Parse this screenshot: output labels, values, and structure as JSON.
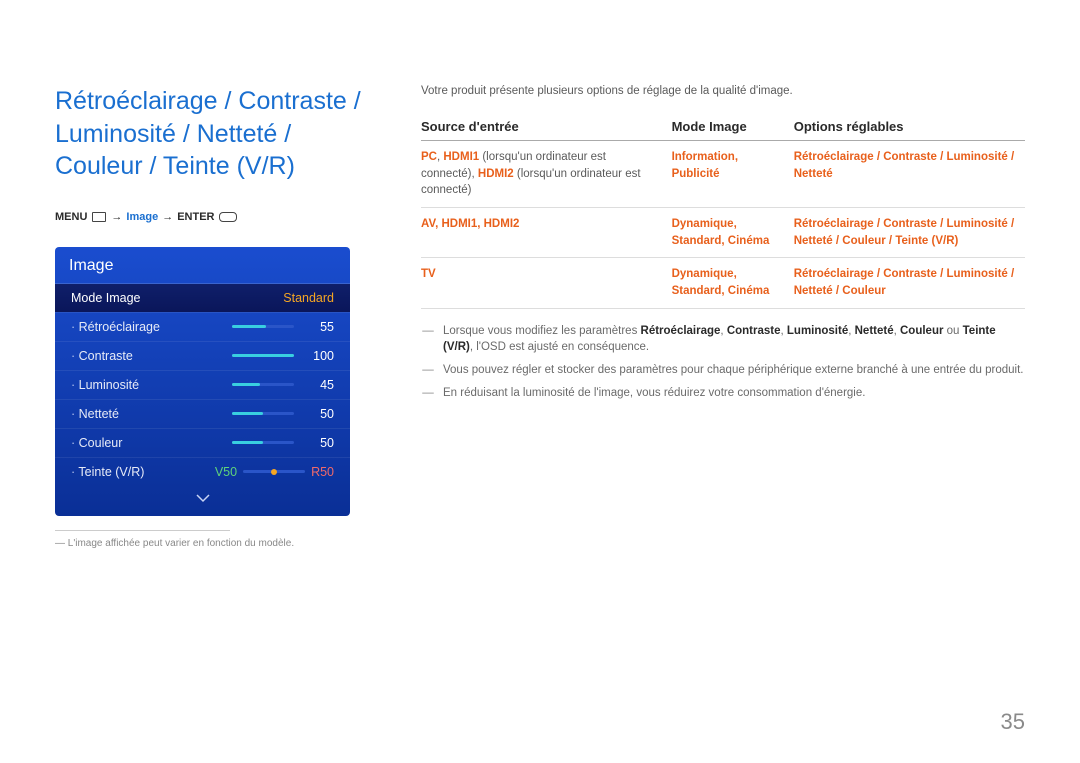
{
  "title": "Rétroéclairage / Contraste / Luminosité / Netteté / Couleur / Teinte (V/R)",
  "breadcrumb": {
    "menu": "MENU",
    "arrow1": "→",
    "image": "Image",
    "arrow2": "→",
    "enter": "ENTER"
  },
  "osd": {
    "title": "Image",
    "selected": {
      "label": "Mode Image",
      "value": "Standard"
    },
    "items": [
      {
        "label": "Rétroéclairage",
        "value": 55,
        "max": 100
      },
      {
        "label": "Contraste",
        "value": 100,
        "max": 100
      },
      {
        "label": "Luminosité",
        "value": 45,
        "max": 100
      },
      {
        "label": "Netteté",
        "value": 50,
        "max": 100
      },
      {
        "label": "Couleur",
        "value": 50,
        "max": 100
      }
    ],
    "tint": {
      "label": "Teinte (V/R)",
      "left": "V50",
      "right": "R50"
    }
  },
  "footnote": "L'image affichée peut varier en fonction du modèle.",
  "intro": "Votre produit présente plusieurs options de réglage de la qualité d'image.",
  "table": {
    "headers": [
      "Source d'entrée",
      "Mode Image",
      "Options réglables"
    ],
    "rows": [
      {
        "src_bold": [
          "PC",
          "HDMI1",
          "HDMI2"
        ],
        "src_text": " (lorsqu'un ordinateur est connecté), ",
        "src_tail": " (lorsqu'un ordinateur est connecté)",
        "mode": "Information, Publicité",
        "opts": "Rétroéclairage / Contraste / Luminosité / Netteté"
      },
      {
        "src_bold2": "AV, HDMI1, HDMI2",
        "mode": "Dynamique, Standard, Cinéma",
        "opts": "Rétroéclairage / Contraste / Luminosité / Netteté / Couleur / Teinte (V/R)"
      },
      {
        "src_bold3": "TV",
        "mode": "Dynamique, Standard, Cinéma",
        "opts": "Rétroéclairage / Contraste / Luminosité / Netteté / Couleur"
      }
    ]
  },
  "notes": [
    {
      "pre": "Lorsque vous modifiez les paramètres ",
      "bold_tokens": [
        "Rétroéclairage",
        "Contraste",
        "Luminosité",
        "Netteté",
        "Couleur",
        "Teinte (V/R)"
      ],
      "sep": ", ",
      "ou": " ou ",
      "post": ", l'OSD est ajusté en conséquence."
    },
    "Vous pouvez régler et stocker des paramètres pour chaque périphérique externe branché à une entrée du produit.",
    "En réduisant la luminosité de l'image, vous réduirez votre consommation d'énergie."
  ],
  "page_number": "35"
}
